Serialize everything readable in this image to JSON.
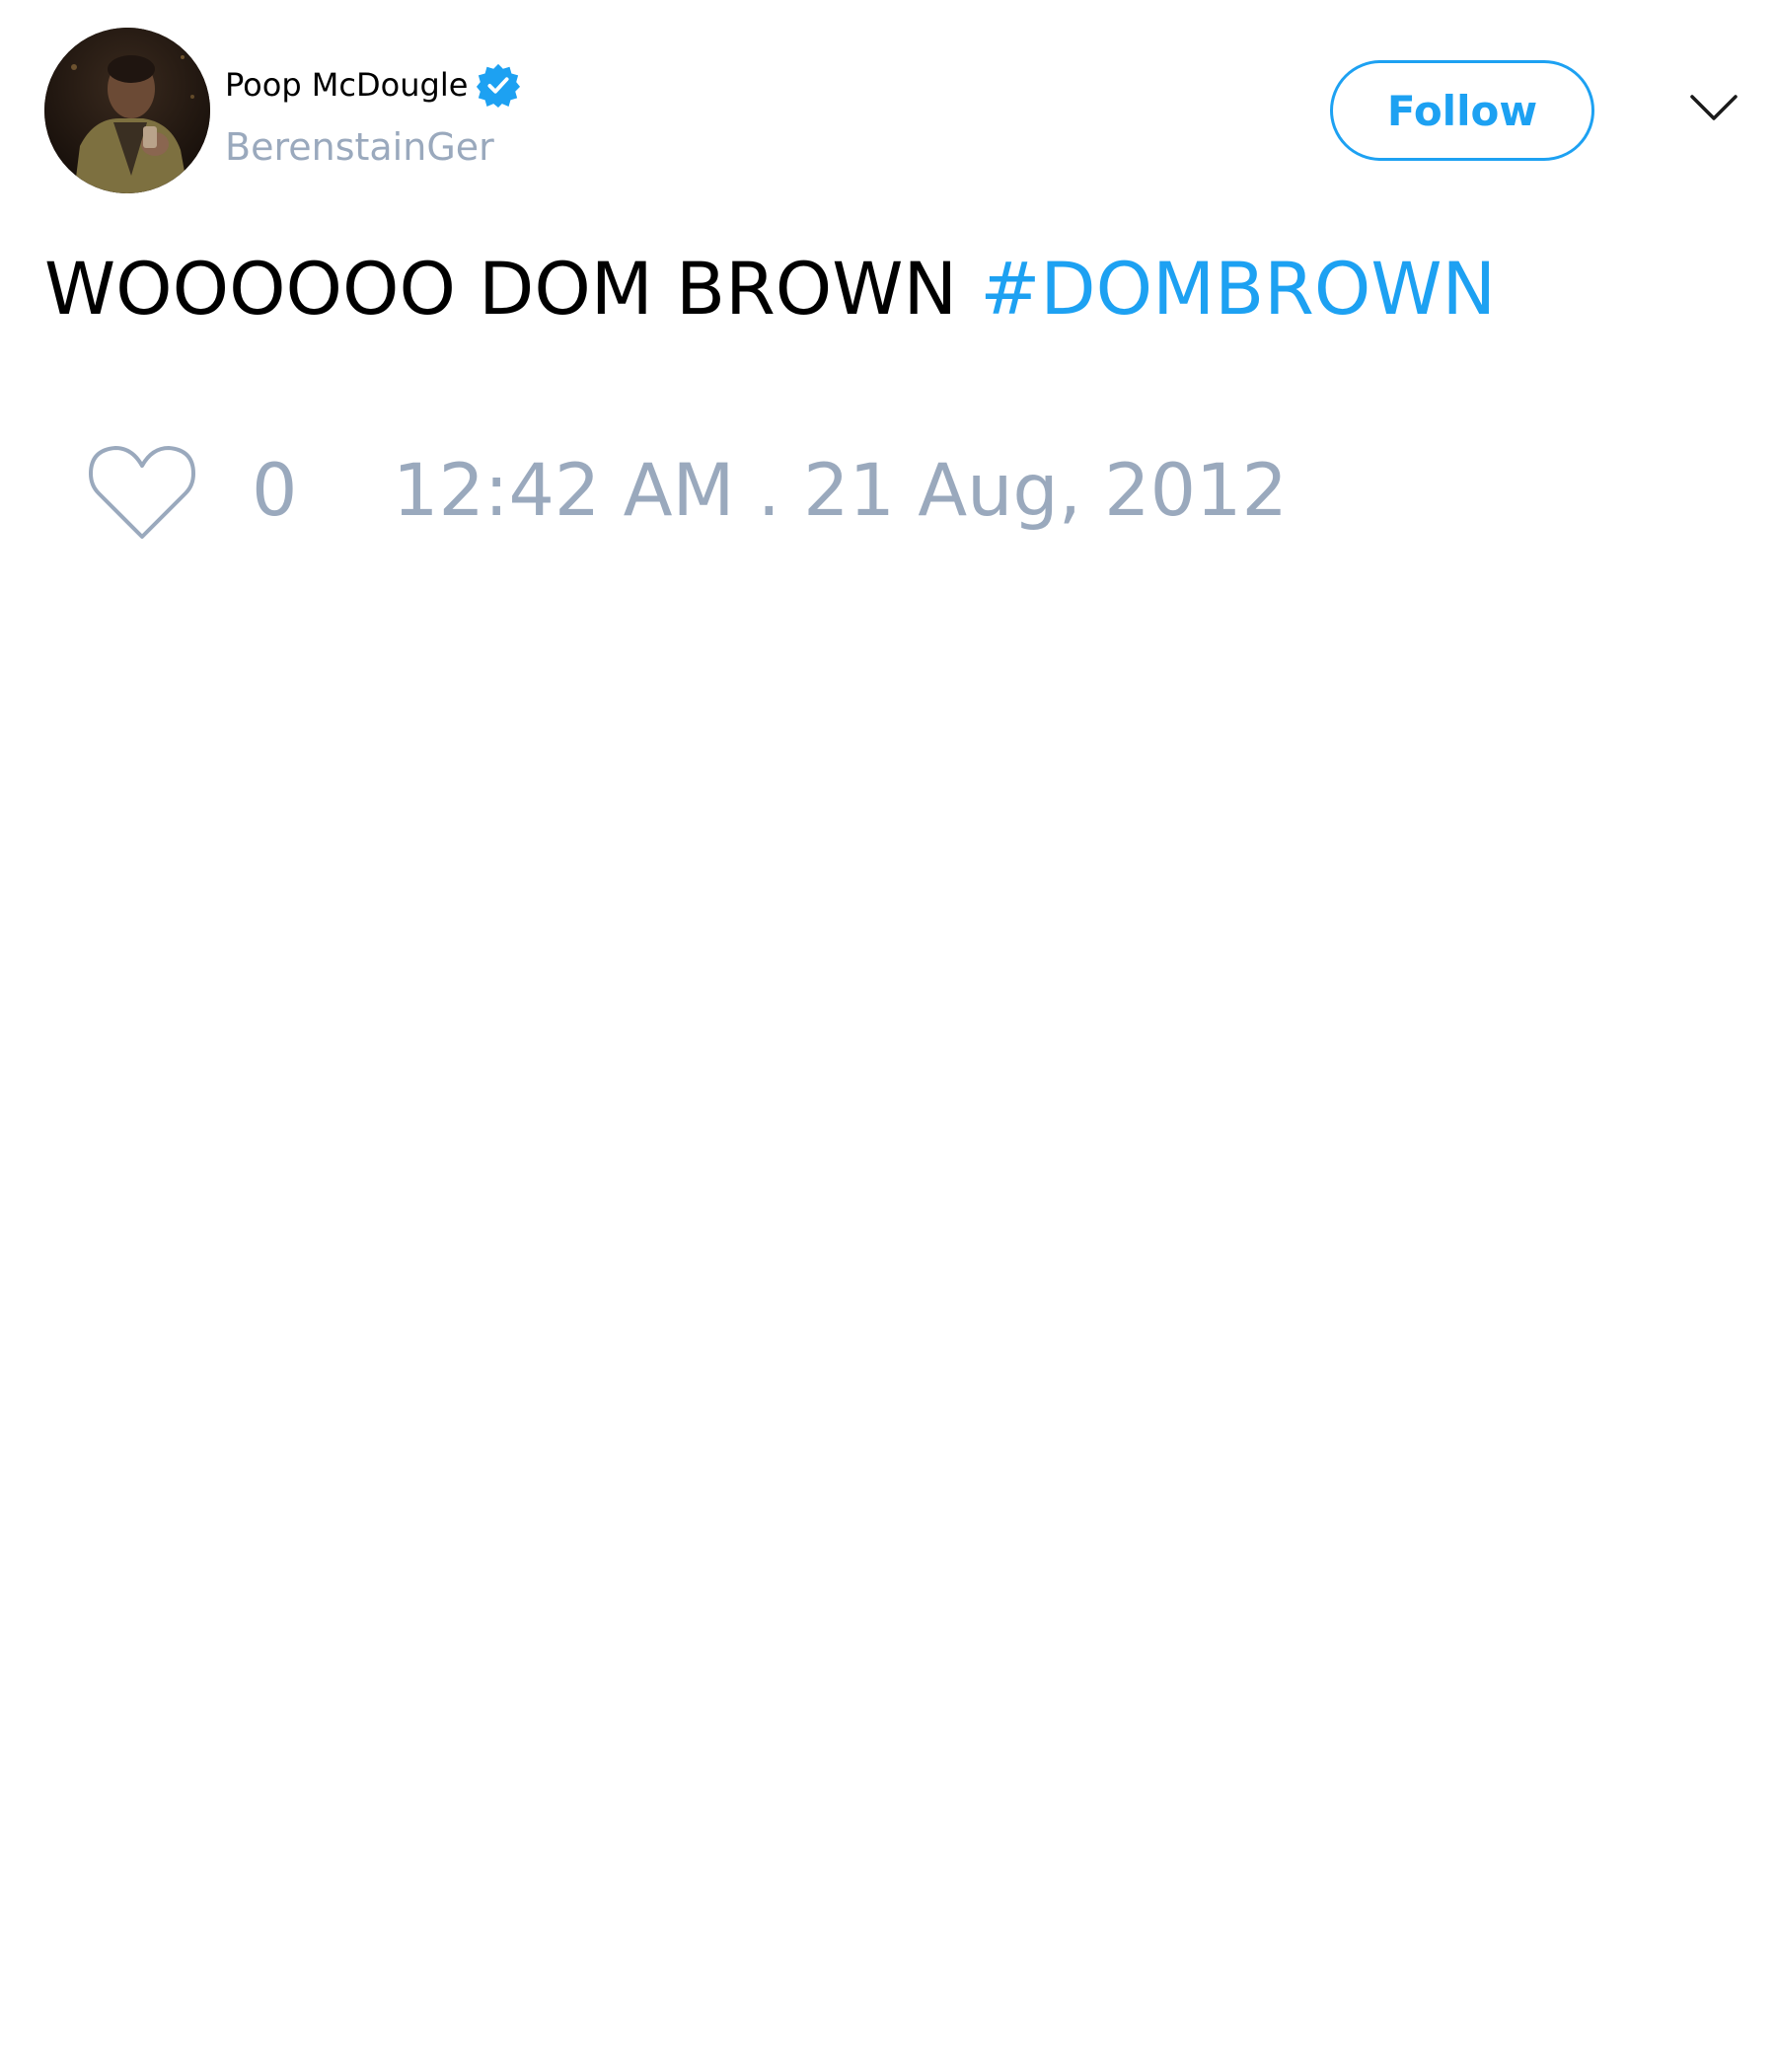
{
  "user": {
    "display_name": "Poop McDougle",
    "handle": "BerenstainGer",
    "verified": true,
    "avatar_icon": "avatar-photo"
  },
  "actions": {
    "follow_label": "Follow",
    "menu_icon": "chevron-down-icon"
  },
  "tweet": {
    "text": "WOOOOOO DOM BROWN ",
    "hashtag": "#DOMBROWN"
  },
  "footer": {
    "like_icon": "heart-icon",
    "like_count": "0",
    "timestamp": "12:42 AM . 21 Aug, 2012"
  },
  "colors": {
    "accent": "#1da1f2",
    "secondary_text": "#9aa9bd",
    "primary_text": "#000000",
    "background": "#ffffff"
  }
}
